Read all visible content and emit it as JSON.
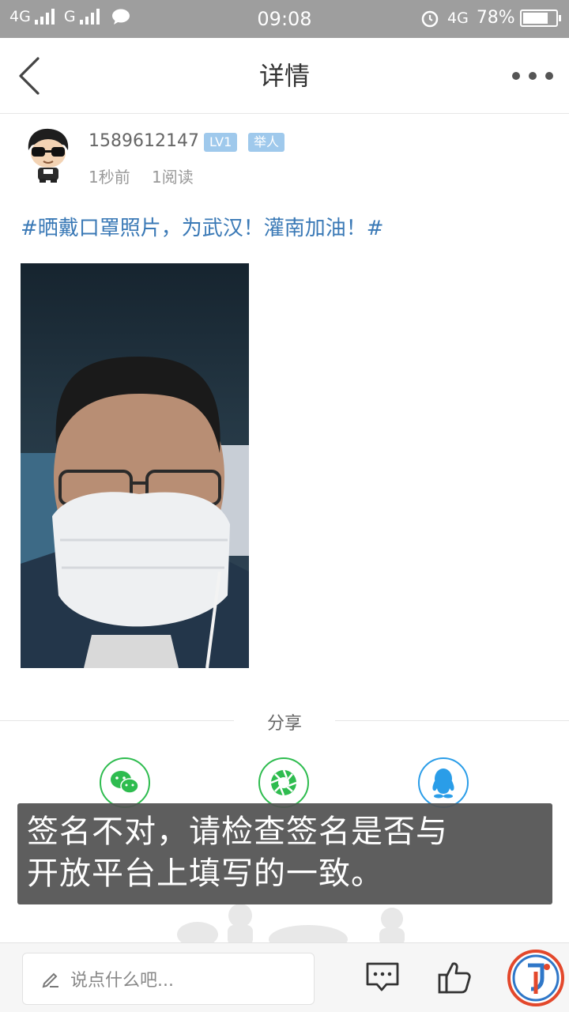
{
  "status_bar": {
    "signal_1": "4G",
    "signal_2": "G",
    "time": "09:08",
    "network": "4G",
    "battery": "78%",
    "battery_level": 0.78
  },
  "nav": {
    "title": "详情"
  },
  "post": {
    "username": "1589612147",
    "level_badge": "LV1",
    "role_badge": "举人",
    "time_ago": "1秒前",
    "reads": "1阅读",
    "text": "#晒戴口罩照片，为武汉！灌南加油！#"
  },
  "share": {
    "title": "分享",
    "targets": [
      "wechat-icon",
      "moments-icon",
      "qq-icon"
    ]
  },
  "toast": {
    "message": "签名不对，请检查签名是否与\n开放平台上填写的一致。"
  },
  "bottom_bar": {
    "comment_placeholder": "说点什么吧..."
  },
  "colors": {
    "status_bar": "#9e9e9e",
    "hashtag_text": "#3a79b6",
    "badge": "#9fc9ec",
    "wechat": "#2ebc4f",
    "qq": "#2a9de8"
  }
}
